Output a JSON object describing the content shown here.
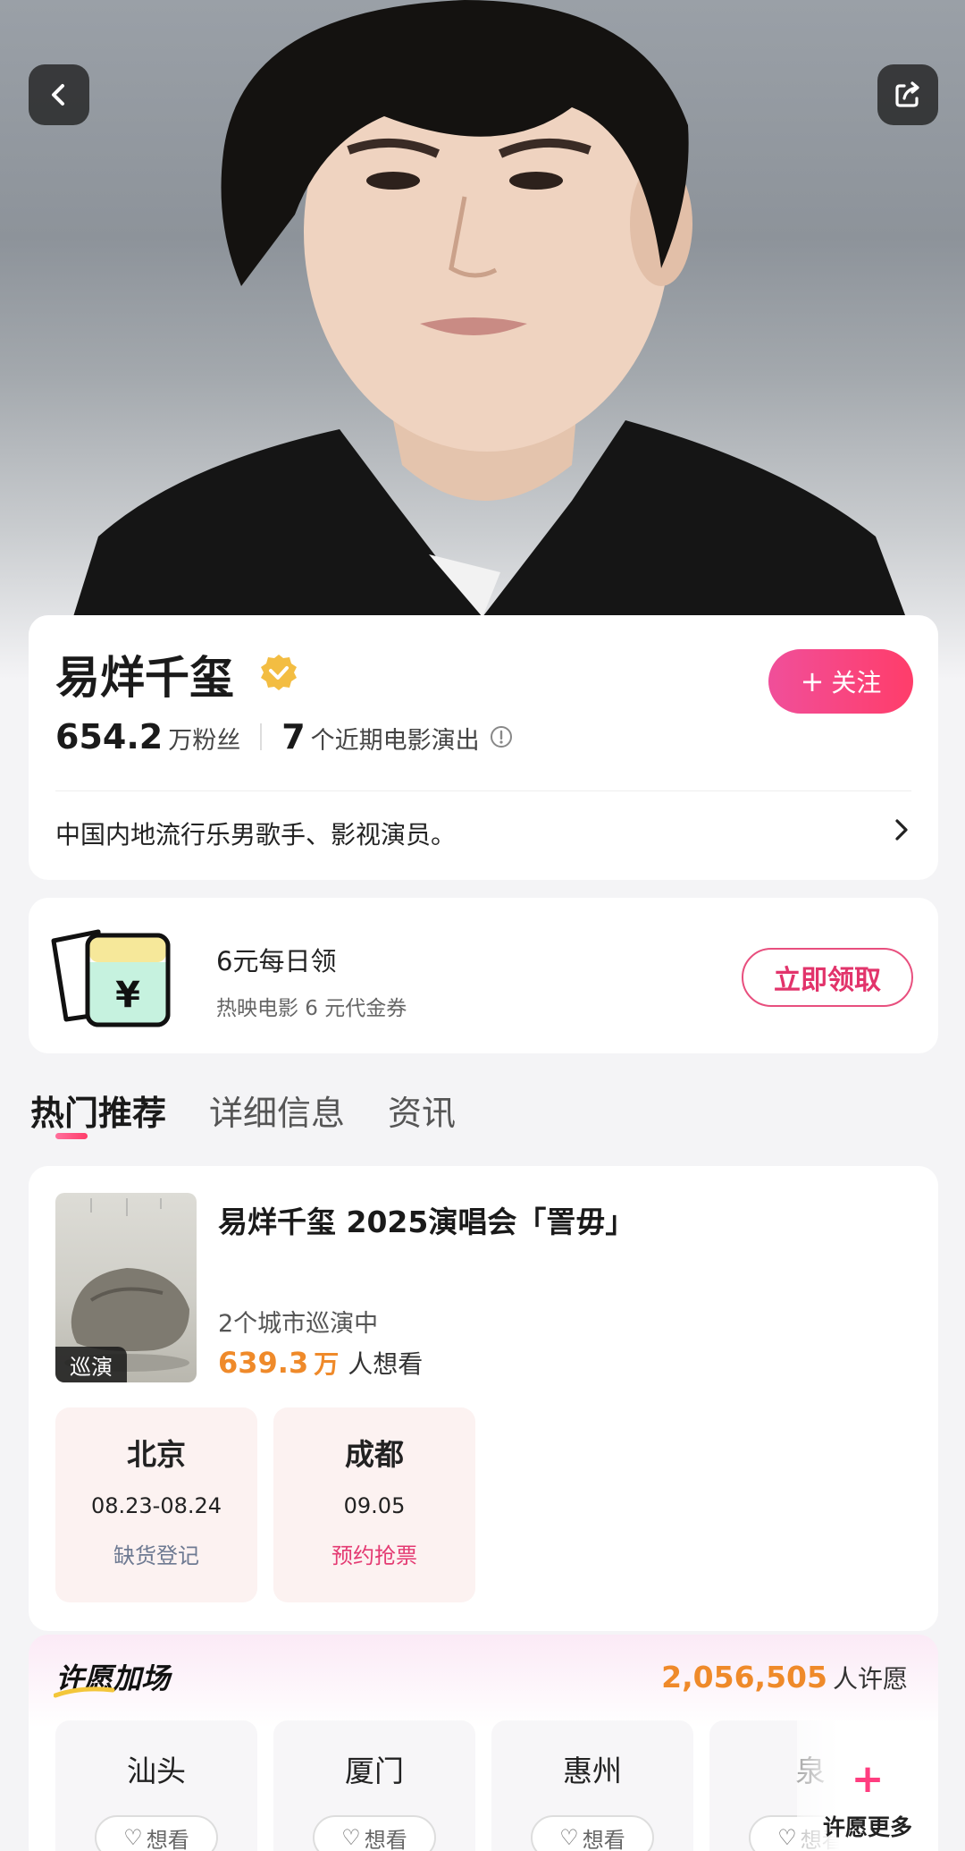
{
  "header": {
    "back_icon": "chevron-left-icon",
    "share_icon": "share-icon"
  },
  "profile": {
    "name": "易烊千玺",
    "verified_icon": "verified-badge-icon",
    "follow_label": "关注",
    "fans_count": "654.2",
    "fans_unit": "万粉丝",
    "shows_count": "7",
    "shows_unit": "个近期电影演出",
    "bio": "中国内地流行乐男歌手、影视演员。"
  },
  "coupon": {
    "title": "6元每日领",
    "subtitle": "热映电影 6 元代金券",
    "claim_label": "立即领取",
    "icon_symbol": "¥"
  },
  "tabs": [
    {
      "label": "热门推荐",
      "active": true
    },
    {
      "label": "详细信息",
      "active": false
    },
    {
      "label": "资讯",
      "active": false
    }
  ],
  "event": {
    "poster_tag": "巡演",
    "title": "易烊千玺 2025演唱会「詈毋」",
    "cities_text": "2个城市巡演中",
    "wants_num": "639.3",
    "wants_unit": "万",
    "wants_text": "人想看",
    "cities": [
      {
        "name": "北京",
        "date": "08.23-08.24",
        "status": "缺货登记",
        "status_color": "#6e7a92"
      },
      {
        "name": "成都",
        "date": "09.05",
        "status": "预约抢票",
        "status_color": "#e43a72"
      }
    ]
  },
  "wish": {
    "title": "许愿加场",
    "count": "2,056,505",
    "count_unit": "人许愿",
    "want_label": "想看",
    "more_label": "许愿更多",
    "cities": [
      "汕头",
      "厦门",
      "惠州",
      "泉"
    ]
  },
  "colors": {
    "accent_pink": "#ff3d6a",
    "accent_orange": "#ef8a2a",
    "verified_gold": "#f3bd42"
  }
}
